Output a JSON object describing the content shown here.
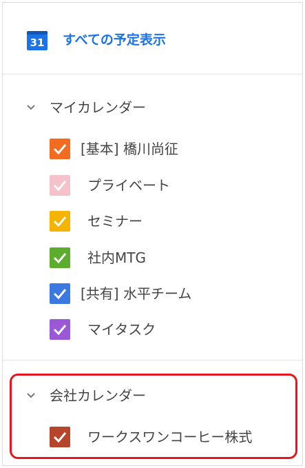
{
  "header": {
    "icon_text": "31",
    "title": "すべての予定表示",
    "accent": "#1a73e8"
  },
  "sections": [
    {
      "title": "マイカレンダー",
      "items": [
        {
          "label": "[基本] 橋川尚征",
          "color": "#f26b21"
        },
        {
          "label": "プライベート",
          "color": "#f5c2cc"
        },
        {
          "label": "セミナー",
          "color": "#f4b400"
        },
        {
          "label": "社内MTG",
          "color": "#5cac2e"
        },
        {
          "label": "[共有] 水平チーム",
          "color": "#3b78e0"
        },
        {
          "label": "マイタスク",
          "color": "#9a58d6"
        }
      ]
    },
    {
      "title": "会社カレンダー",
      "items": [
        {
          "label": "ワークスワンコーヒー株式",
          "color": "#b5462c"
        }
      ]
    }
  ],
  "highlight_color": "#e8141c"
}
